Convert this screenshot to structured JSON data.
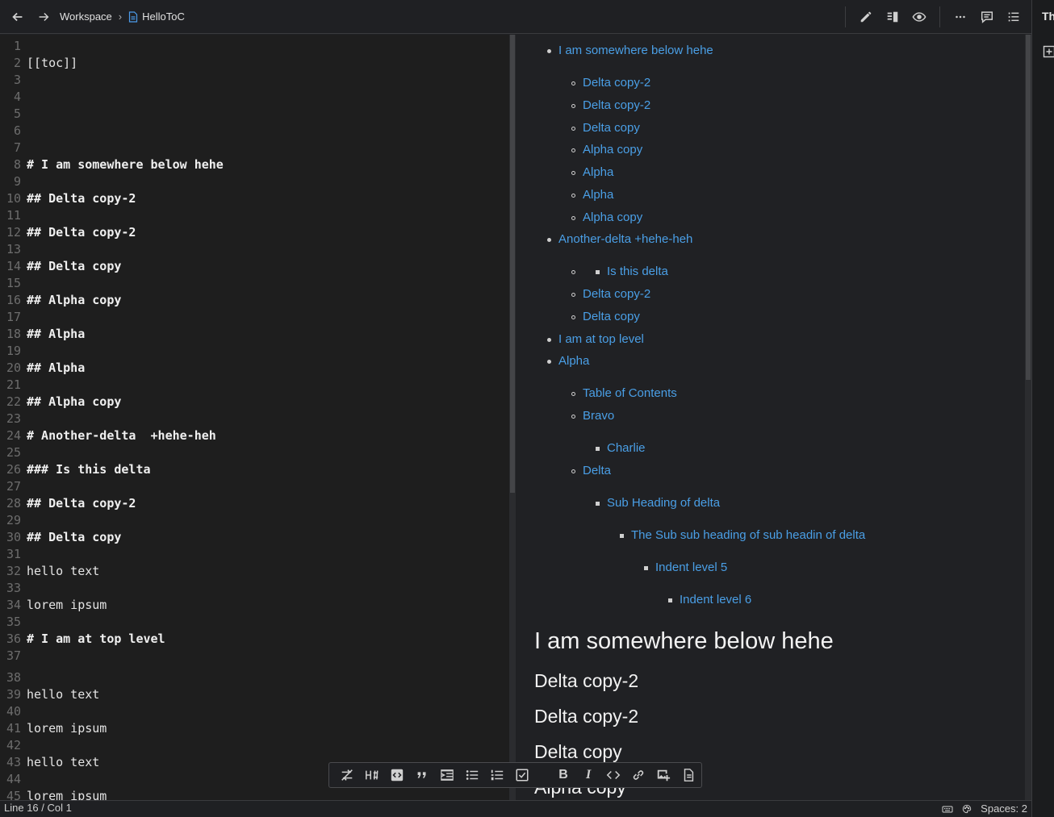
{
  "header": {
    "breadcrumb": [
      "Workspace",
      "HelloToC"
    ],
    "tools": [
      "edit-icon",
      "split-view-icon",
      "preview-icon",
      "more-icon",
      "comments-icon",
      "outline-icon"
    ]
  },
  "sidebar": {
    "title": "Th"
  },
  "editor": {
    "lines": [
      {
        "n": "1",
        "t": ""
      },
      {
        "n": "2",
        "t": "[[toc]]"
      },
      {
        "n": "3",
        "t": ""
      },
      {
        "n": "4",
        "t": ""
      },
      {
        "n": "5",
        "t": ""
      },
      {
        "n": "6",
        "t": ""
      },
      {
        "n": "7",
        "t": ""
      },
      {
        "n": "8",
        "t": "# I am somewhere below hehe"
      },
      {
        "n": "9",
        "t": ""
      },
      {
        "n": "10",
        "t": "## Delta copy-2"
      },
      {
        "n": "11",
        "t": ""
      },
      {
        "n": "12",
        "t": "## Delta copy-2"
      },
      {
        "n": "13",
        "t": ""
      },
      {
        "n": "14",
        "t": "## Delta copy"
      },
      {
        "n": "15",
        "t": ""
      },
      {
        "n": "16",
        "t": "## Alpha copy"
      },
      {
        "n": "17",
        "t": ""
      },
      {
        "n": "18",
        "t": "## Alpha"
      },
      {
        "n": "19",
        "t": ""
      },
      {
        "n": "20",
        "t": "## Alpha"
      },
      {
        "n": "21",
        "t": ""
      },
      {
        "n": "22",
        "t": "## Alpha copy"
      },
      {
        "n": "23",
        "t": ""
      },
      {
        "n": "24",
        "t": "# Another-delta  +hehe-heh"
      },
      {
        "n": "25",
        "t": ""
      },
      {
        "n": "26",
        "t": "### Is this delta"
      },
      {
        "n": "27",
        "t": ""
      },
      {
        "n": "28",
        "t": "## Delta copy-2"
      },
      {
        "n": "29",
        "t": ""
      },
      {
        "n": "30",
        "t": "## Delta copy"
      },
      {
        "n": "31",
        "t": ""
      },
      {
        "n": "32",
        "t": "hello text"
      },
      {
        "n": "33",
        "t": ""
      },
      {
        "n": "34",
        "t": "lorem ipsum"
      },
      {
        "n": "35",
        "t": ""
      },
      {
        "n": "36",
        "t": "# I am at top level"
      },
      {
        "n": "37",
        "t": ""
      },
      {
        "n": "38",
        "t": ""
      },
      {
        "n": "39",
        "t": "hello text"
      },
      {
        "n": "40",
        "t": ""
      },
      {
        "n": "41",
        "t": "lorem ipsum"
      },
      {
        "n": "42",
        "t": ""
      },
      {
        "n": "43",
        "t": "hello text"
      },
      {
        "n": "44",
        "t": ""
      },
      {
        "n": "45",
        "t": "lorem ipsum"
      }
    ]
  },
  "preview": {
    "toc": [
      {
        "text": "I am somewhere below hehe",
        "level": 1
      },
      {
        "text": "Delta copy-2",
        "level": 2
      },
      {
        "text": "Delta copy-2",
        "level": 2
      },
      {
        "text": "Delta copy",
        "level": 2
      },
      {
        "text": "Alpha copy",
        "level": 2
      },
      {
        "text": "Alpha",
        "level": 2
      },
      {
        "text": "Alpha",
        "level": 2
      },
      {
        "text": "Alpha copy",
        "level": 2
      },
      {
        "text": "Another-delta +hehe-heh",
        "level": 1
      },
      {
        "text": "Is this delta",
        "level": 3
      },
      {
        "text": "Delta copy-2",
        "level": 2
      },
      {
        "text": "Delta copy",
        "level": 2
      },
      {
        "text": "I am at top level",
        "level": 1
      },
      {
        "text": "Alpha",
        "level": 1
      },
      {
        "text": "Table of Contents",
        "level": 2
      },
      {
        "text": "Bravo",
        "level": 2
      },
      {
        "text": "Charlie",
        "level": 3
      },
      {
        "text": "Delta",
        "level": 2
      },
      {
        "text": "Sub Heading of delta",
        "level": 3
      },
      {
        "text": "The Sub sub heading of sub headin of delta",
        "level": 4
      },
      {
        "text": "Indent level 5",
        "level": 5
      },
      {
        "text": "Indent level 6",
        "level": 6
      }
    ],
    "headings": [
      {
        "text": "I am somewhere below hehe",
        "level": 1
      },
      {
        "text": "Delta copy-2",
        "level": 2
      },
      {
        "text": "Delta copy-2",
        "level": 2
      },
      {
        "text": "Delta copy",
        "level": 2
      },
      {
        "text": "Alpha copy",
        "level": 2
      }
    ]
  },
  "format_toolbar": [
    "toggle-sync-icon",
    "heading-icon",
    "code-block-icon",
    "quote-icon",
    "indent-icon",
    "bullet-list-icon",
    "numbered-list-icon",
    "checklist-icon",
    "bold-icon",
    "italic-icon",
    "inline-code-icon",
    "link-icon",
    "image-icon",
    "file-icon"
  ],
  "status": {
    "position": "Line 16 / Col 1",
    "spaces": "Spaces: 2"
  },
  "colors": {
    "link": "#4a9fe6",
    "background": "#202124",
    "editor_bg": "#1e1e1e"
  }
}
